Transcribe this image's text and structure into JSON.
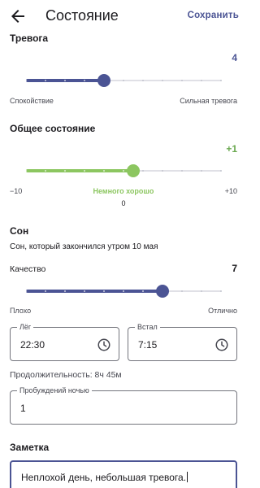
{
  "header": {
    "title": "Состояние",
    "save_label": "Сохранить",
    "back_icon": "arrow-left-icon"
  },
  "anxiety": {
    "title": "Тревога",
    "value": "4",
    "value_num": 4,
    "min": 0,
    "max": 10,
    "min_label": "Спокойствие",
    "max_label": "Сильная тревога",
    "active_color": "#4b5494",
    "inactive_color": "#e0e0e6"
  },
  "overall": {
    "title": "Общее состояние",
    "value": "+1",
    "value_num": 1,
    "min": -10,
    "max": 10,
    "min_label": "−10",
    "max_label": "+10",
    "mood_label": "Немного хорошо",
    "zero_label": "0",
    "active_color": "#8cc660",
    "value_color": "#6aa84f"
  },
  "sleep": {
    "title": "Сон",
    "subtitle": "Сон, который закончился утром 10 мая",
    "quality_label": "Качество",
    "quality_value": "7",
    "quality_num": 7,
    "quality_min": 0,
    "quality_max": 10,
    "quality_min_label": "Плохо",
    "quality_max_label": "Отлично",
    "went_to_bed_label": "Лёг",
    "went_to_bed_value": "22:30",
    "woke_up_label": "Встал",
    "woke_up_value": "7:15",
    "clock_icon": "clock-icon",
    "duration_text": "Продолжительность: 8ч 45м",
    "awakenings_label": "Пробуждений ночью",
    "awakenings_value": "1",
    "active_color": "#4b5494"
  },
  "note": {
    "title": "Заметка",
    "value": "Неплохой день, небольшая тревога."
  }
}
